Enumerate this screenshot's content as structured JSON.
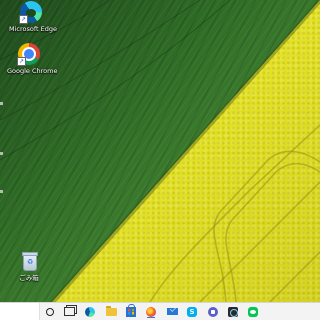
{
  "desktop": {
    "icons": [
      {
        "label": "Microsoft Edge",
        "icon": "edge-icon"
      },
      {
        "label": "Google Chrome",
        "icon": "chrome-icon"
      },
      {
        "label": "ごみ箱",
        "icon": "recycle-bin-icon"
      }
    ],
    "wallpaper": {
      "green": "#2e6b25",
      "yellow": "#e3e124"
    }
  },
  "taskbar": {
    "search": {
      "placeholder": "",
      "value": ""
    },
    "apps": [
      {
        "name": "cortana",
        "icon": "cortana-circle-icon"
      },
      {
        "name": "task-view",
        "icon": "task-view-icon"
      },
      {
        "name": "edge",
        "icon": "edge-icon"
      },
      {
        "name": "file-explorer",
        "icon": "folder-icon"
      },
      {
        "name": "microsoft-store",
        "icon": "store-bag-icon"
      },
      {
        "name": "firefox",
        "icon": "firefox-icon"
      },
      {
        "name": "mail",
        "icon": "mail-icon"
      },
      {
        "name": "skype",
        "icon": "skype-icon"
      },
      {
        "name": "teams",
        "icon": "teams-icon"
      },
      {
        "name": "app",
        "icon": "app-icon"
      },
      {
        "name": "line",
        "icon": "line-icon"
      }
    ],
    "skype_glyph": "S",
    "bin_glyph": "♻"
  }
}
